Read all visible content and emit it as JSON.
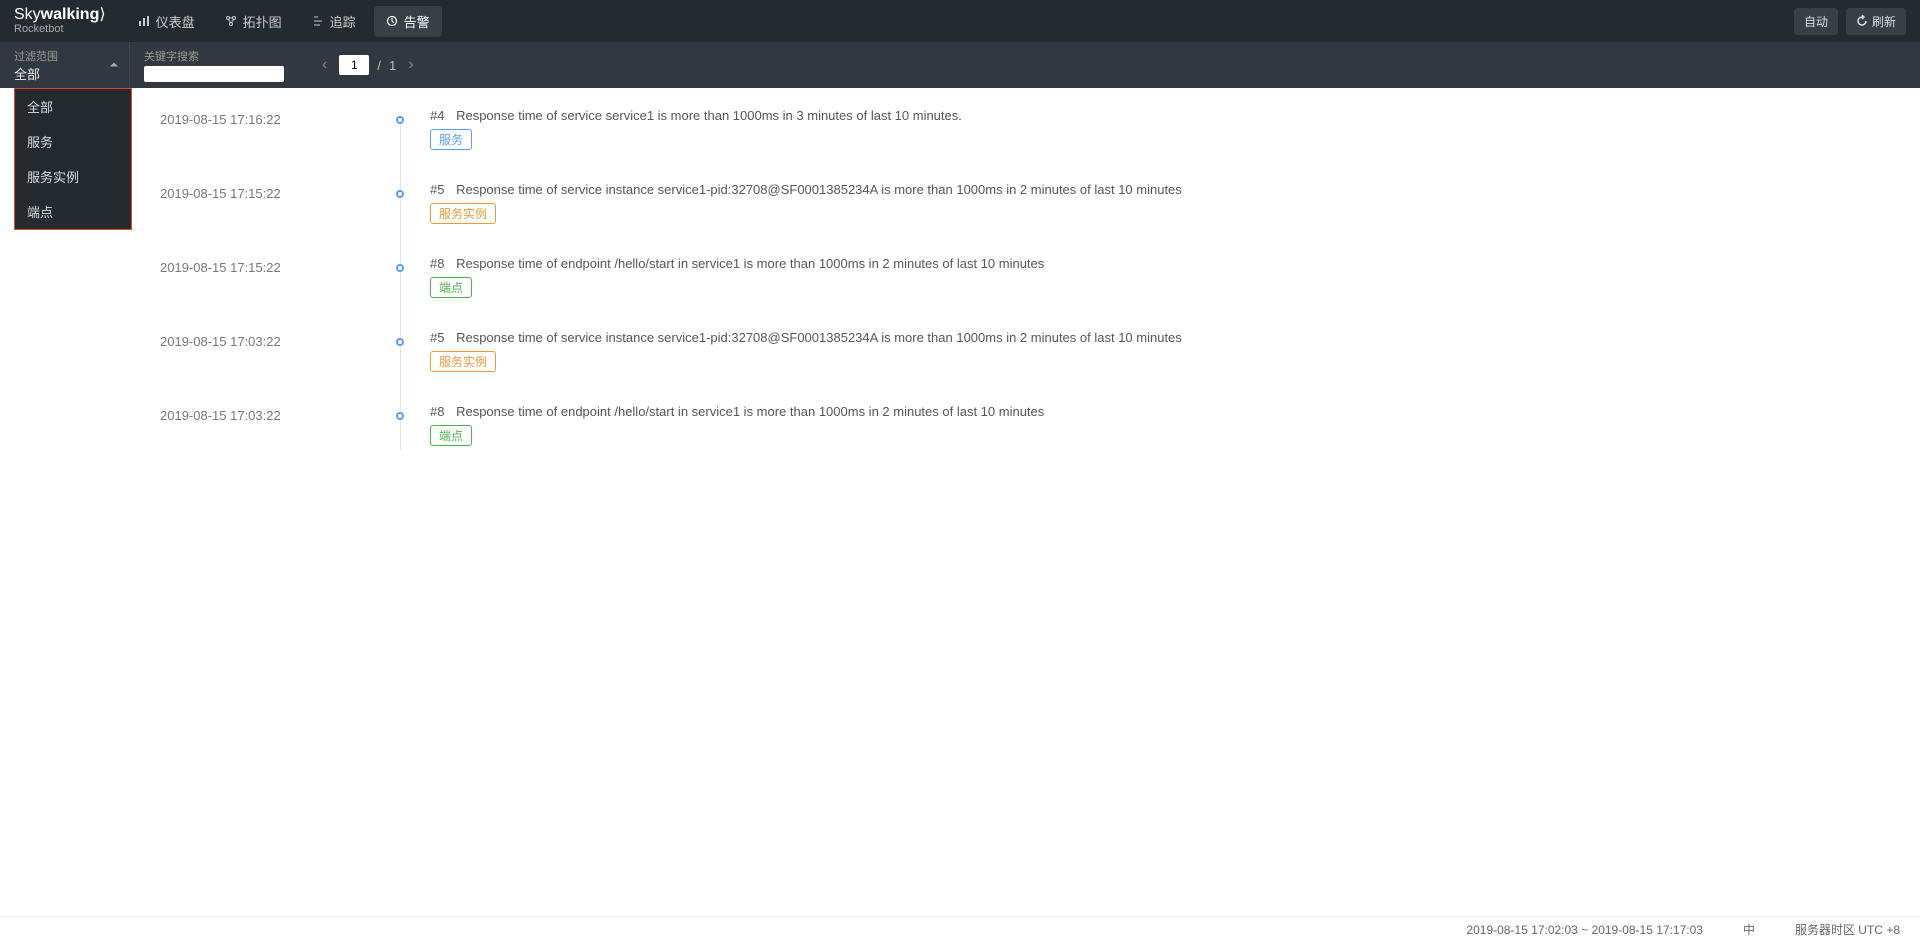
{
  "logo": {
    "main1": "Sky",
    "main2": "walking",
    "sub": "Rocketbot"
  },
  "nav": {
    "dashboard": "仪表盘",
    "topology": "拓扑图",
    "trace": "追踪",
    "alarm": "告警"
  },
  "topRight": {
    "auto": "自动",
    "refresh": "刷新"
  },
  "filter": {
    "scopeLabel": "过滤范围",
    "scopeValue": "全部",
    "keywordLabel": "关键字搜索",
    "keywordValue": ""
  },
  "dropdown": {
    "items": [
      "全部",
      "服务",
      "服务实例",
      "端点"
    ]
  },
  "pager": {
    "current": "1",
    "sep": "/",
    "total": "1"
  },
  "tags": {
    "service": "服务",
    "instance": "服务实例",
    "endpoint": "端点"
  },
  "alarms": [
    {
      "time": "2019-08-15 17:16:22",
      "idx": "#4",
      "msg": "Response time of service service1 is more than 1000ms in 3 minutes of last 10 minutes.",
      "type": "service"
    },
    {
      "time": "2019-08-15 17:15:22",
      "idx": "#5",
      "msg": "Response time of service instance service1-pid:32708@SF0001385234A is more than 1000ms in 2 minutes of last 10 minutes",
      "type": "instance"
    },
    {
      "time": "2019-08-15 17:15:22",
      "idx": "#8",
      "msg": "Response time of endpoint /hello/start in service1 is more than 1000ms in 2 minutes of last 10 minutes",
      "type": "endpoint"
    },
    {
      "time": "2019-08-15 17:03:22",
      "idx": "#5",
      "msg": "Response time of service instance service1-pid:32708@SF0001385234A is more than 1000ms in 2 minutes of last 10 minutes",
      "type": "instance"
    },
    {
      "time": "2019-08-15 17:03:22",
      "idx": "#8",
      "msg": "Response time of endpoint /hello/start in service1 is more than 1000ms in 2 minutes of last 10 minutes",
      "type": "endpoint"
    }
  ],
  "footer": {
    "range": "2019-08-15 17:02:03 ~ 2019-08-15 17:17:03",
    "lang": "中",
    "tzLabel": "服务器时区 UTC",
    "tzOffset": "+8"
  }
}
